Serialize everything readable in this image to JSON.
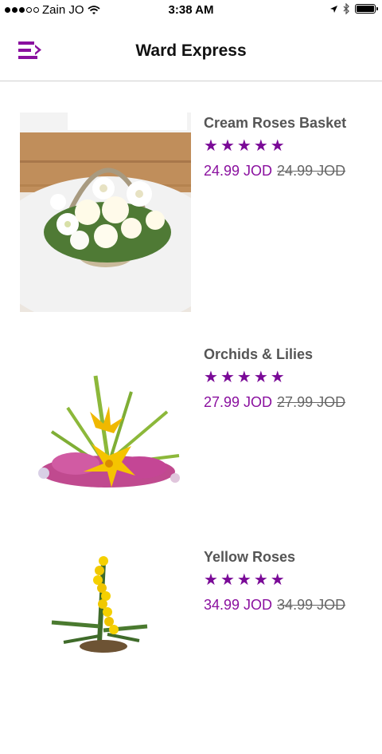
{
  "status_bar": {
    "carrier": "Zain JO",
    "time": "3:38 AM"
  },
  "header": {
    "title": "Ward Express"
  },
  "products": [
    {
      "name": "Cream Roses Basket",
      "rating": 5,
      "price": "24.99 JOD",
      "old_price": "24.99 JOD"
    },
    {
      "name": "Orchids & Lilies",
      "rating": 5,
      "price": "27.99 JOD",
      "old_price": "27.99 JOD"
    },
    {
      "name": "Yellow Roses",
      "rating": 5,
      "price": "34.99 JOD",
      "old_price": "34.99 JOD"
    }
  ],
  "colors": {
    "accent": "#8a109f",
    "star": "#7a0a97"
  }
}
